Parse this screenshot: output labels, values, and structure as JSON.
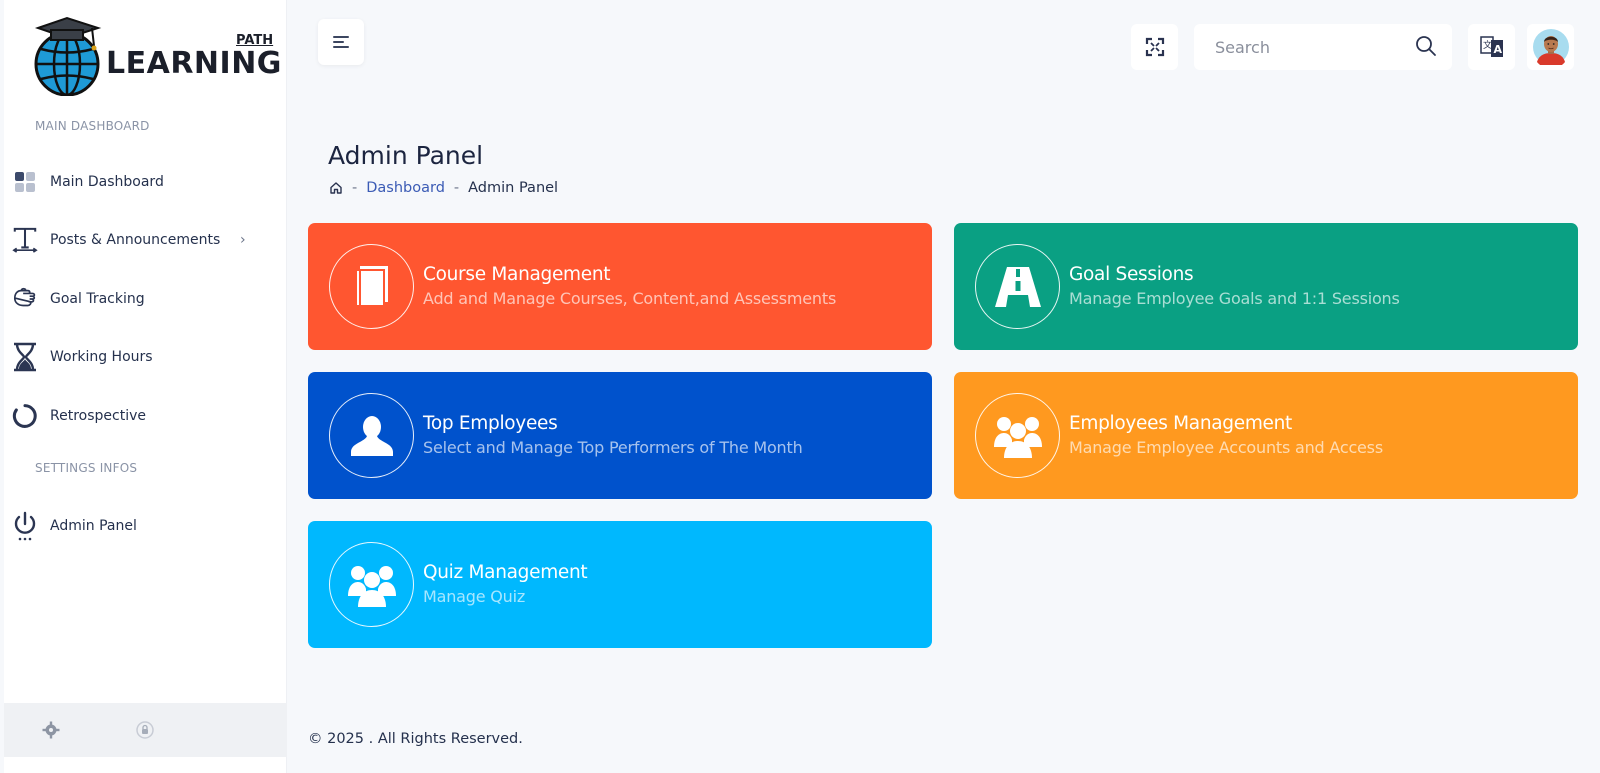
{
  "brand": {
    "logo_main": "LEARNING",
    "logo_sup": "PATH"
  },
  "sidebar": {
    "section_main": "MAIN DASHBOARD",
    "section_settings": "SETTINGS INFOS",
    "items": [
      {
        "label": "Main Dashboard",
        "icon": "dashboard-grid-icon"
      },
      {
        "label": "Posts & Announcements",
        "icon": "text-type-icon",
        "chevron": "›"
      },
      {
        "label": "Goal Tracking",
        "icon": "hand-icon"
      },
      {
        "label": "Working Hours",
        "icon": "hourglass-icon"
      },
      {
        "label": "Retrospective",
        "icon": "spinner-icon"
      }
    ],
    "settings_items": [
      {
        "label": "Admin Panel",
        "icon": "power-icon"
      }
    ]
  },
  "header": {
    "search_placeholder": "Search"
  },
  "page": {
    "title": "Admin Panel",
    "breadcrumb": {
      "link": "Dashboard",
      "current": "Admin Panel",
      "sep": "-"
    }
  },
  "cards": [
    {
      "title": "Course Management",
      "subtitle": "Add and Manage Courses, Content,and Assessments",
      "color": "#ff5630",
      "icon": "book-icon"
    },
    {
      "title": "Goal Sessions",
      "subtitle": "Manage Employee Goals and 1:1 Sessions",
      "color": "#0aa083",
      "icon": "road-icon"
    },
    {
      "title": "Top Employees",
      "subtitle": "Select and Manage Top Performers of The Month",
      "color": "#0052cc",
      "icon": "user-icon"
    },
    {
      "title": "Employees Management",
      "subtitle": "Manage Employee Accounts and Access",
      "color": "#ff991f",
      "icon": "users-group-icon"
    },
    {
      "title": "Quiz Management",
      "subtitle": "Manage Quiz",
      "color": "#00b8fe",
      "icon": "users-group-icon"
    }
  ],
  "footer": {
    "copyright": "© 2025 . All Rights Reserved."
  }
}
